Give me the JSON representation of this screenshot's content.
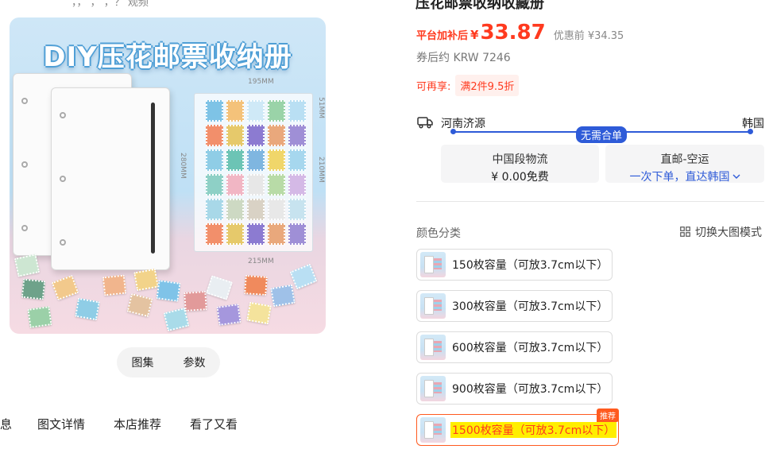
{
  "top_cut_text": "，，  ，   ，？ 观频",
  "product": {
    "title": "压花邮票收纳收藏册",
    "image_title": "DIY压花邮票收纳册",
    "image_dims": {
      "width_top": "195MM",
      "height_right": "51MM",
      "height_left": "280MM",
      "height_right2": "210MM",
      "width_bottom": "215MM"
    },
    "price_label": "平台加补后",
    "currency": "¥",
    "price": "33.87",
    "original_price": "优惠前 ¥34.35",
    "krw": "券后约 KRW 7246",
    "promo_label": "可再享:",
    "promo_badge": "满2件9.5折"
  },
  "gallery_tabs": [
    "图集",
    "参数"
  ],
  "detail_tabs": [
    "息",
    "图文详情",
    "本店推荐",
    "看了又看"
  ],
  "shipping": {
    "from": "河南济源",
    "to": "韩国",
    "badge": "无需合单",
    "card1_line1": "中国段物流",
    "card1_line2": "¥ 0.00免费",
    "card2_line1": "直邮-空运",
    "card2_line2": "一次下单，直达韩国"
  },
  "sku_section": {
    "label": "颜色分类",
    "switch_mode": "切换大图模式",
    "options": [
      {
        "label": "150枚容量（可放3.7cm以下）",
        "selected": false
      },
      {
        "label": "300枚容量（可放3.7cm以下）",
        "selected": false
      },
      {
        "label": "600枚容量（可放3.7cm以下）",
        "selected": false
      },
      {
        "label": "900枚容量（可放3.7cm以下）",
        "selected": false
      },
      {
        "label": "1500枚容量（可放3.7cm以下）",
        "selected": true,
        "badge": "推荐"
      }
    ]
  },
  "colors": {
    "accent_red": "#ff3a1f",
    "accent_blue": "#2e5bd8",
    "highlight": "#ffee00"
  }
}
